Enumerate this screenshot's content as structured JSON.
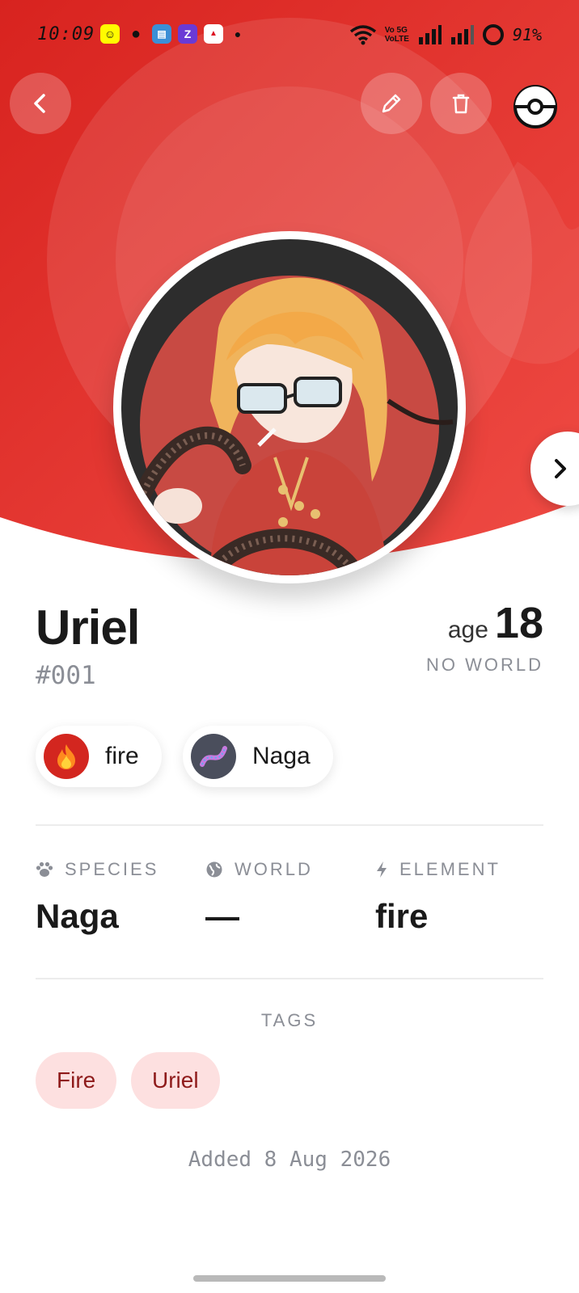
{
  "status_bar": {
    "time": "10:09",
    "network_label": "Vo 5G\nVoLTE",
    "battery_percent": "91%",
    "app_icons": [
      "snapchat-icon",
      "messages-icon",
      "gallery-icon",
      "zomato-icon",
      "pizza-hut-icon"
    ]
  },
  "header": {
    "back_icon": "chevron-left-icon",
    "edit_icon": "pencil-icon",
    "delete_icon": "trash-icon",
    "pokeball_icon": "pokeball-icon",
    "next_icon": "chevron-right-icon",
    "accent_color": "#e0312d"
  },
  "character": {
    "name": "Uriel",
    "number": "#001",
    "age_label": "age",
    "age": "18",
    "world_caption": "NO WORLD"
  },
  "chips": [
    {
      "label": "fire",
      "icon": "flame-icon"
    },
    {
      "label": "Naga",
      "icon": "naga-avatar"
    }
  ],
  "stats": [
    {
      "label": "SPECIES",
      "value": "Naga",
      "icon": "paw-icon"
    },
    {
      "label": "WORLD",
      "value": "—",
      "icon": "globe-icon"
    },
    {
      "label": "ELEMENT",
      "value": "fire",
      "icon": "bolt-icon"
    }
  ],
  "tags": {
    "title": "TAGS",
    "items": [
      "Fire",
      "Uriel"
    ]
  },
  "footer": {
    "added": "Added 8 Aug 2026"
  }
}
